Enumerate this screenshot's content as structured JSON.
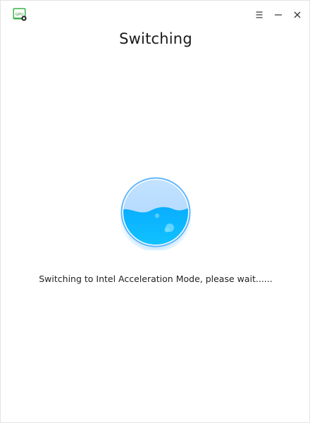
{
  "app": {
    "icon_name": "gpu-switch-app-icon",
    "icon_text": "GPU"
  },
  "titlebar": {
    "menu_icon": "hamburger-menu-icon",
    "minimize_icon": "minimize-icon",
    "close_icon": "close-icon"
  },
  "main": {
    "title": "Switching",
    "status": "Switching to Intel Acceleration Mode, please wait......"
  },
  "indicator": {
    "icon_name": "water-level-progress-icon",
    "colors": {
      "water": "#11b9ff",
      "empty": "#b6dcff",
      "rim": "#61b8ff"
    }
  }
}
